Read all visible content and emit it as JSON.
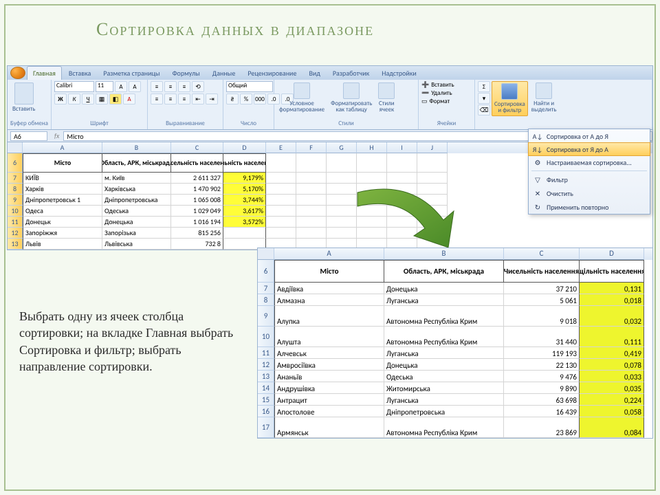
{
  "slide": {
    "title": "Сортировка данных в диапазоне"
  },
  "ribbon": {
    "tabs": [
      "Главная",
      "Вставка",
      "Разметка страницы",
      "Формулы",
      "Данные",
      "Рецензирование",
      "Вид",
      "Разработчик",
      "Надстройки"
    ],
    "active_tab": 0,
    "clipboard": {
      "paste": "Вставить",
      "label": "Буфер обмена"
    },
    "font": {
      "name": "Calibri",
      "size": "11",
      "label": "Шрифт"
    },
    "alignment": {
      "label": "Выравнивание"
    },
    "number": {
      "format": "Общий",
      "label": "Число"
    },
    "styles": {
      "cond_format": "Условное\nформатирование",
      "as_table": "Форматировать\nкак таблицу",
      "cell_styles": "Стили\nячеек",
      "label": "Стили"
    },
    "cells": {
      "insert": "Вставить",
      "delete": "Удалить",
      "format": "Формат",
      "label": "Ячейки"
    },
    "editing": {
      "sort_filter": "Сортировка\nи фильтр",
      "find_select": "Найти и\nвыделить"
    }
  },
  "formula_bar": {
    "name_box": "A6",
    "content": "Місто"
  },
  "sheet1": {
    "cols": [
      "A",
      "B",
      "C",
      "D",
      "E",
      "F",
      "G",
      "H",
      "I",
      "J"
    ],
    "headers": [
      "Місто",
      "Область, АРК, міськрада",
      "Чисельність населення",
      "щільність населення"
    ],
    "rows": [
      {
        "n": "7",
        "a": "КИЇВ",
        "b": "м. Київ",
        "c": "2 611 327",
        "d": "9,179%"
      },
      {
        "n": "8",
        "a": "Харків",
        "b": "Харківська",
        "c": "1 470 902",
        "d": "5,170%"
      },
      {
        "n": "9",
        "a": "Дніпропетровськ 1",
        "b": "Дніпропетровська",
        "c": "1 065 008",
        "d": "3,744%"
      },
      {
        "n": "10",
        "a": "Одеса",
        "b": "Одеська",
        "c": "1 029 049",
        "d": "3,617%"
      },
      {
        "n": "11",
        "a": "Донецьк",
        "b": "Донецька",
        "c": "1 016 194",
        "d": "3,572%"
      },
      {
        "n": "12",
        "a": "Запоріжжя",
        "b": "Запорізька",
        "c": "815 256",
        "d": ""
      },
      {
        "n": "13",
        "a": "Львів",
        "b": "Львівська",
        "c": "732 8",
        "d": ""
      }
    ]
  },
  "sort_menu": {
    "az": "Сортировка от А до Я",
    "za": "Сортировка от Я до А",
    "custom": "Настраиваемая сортировка...",
    "filter": "Фильтр",
    "clear": "Очистить",
    "reapply": "Применить повторно"
  },
  "instructions": {
    "text": "Выбрать одну из ячеек столбца сортировки; на вкладке Главная выбрать Сортировка и фильтр; выбрать направление сортировки."
  },
  "sheet2": {
    "cols": [
      "A",
      "B",
      "C",
      "D"
    ],
    "headers": [
      "Місто",
      "Область, АРК, міськрада",
      "Чисельність населення",
      "щільність населення"
    ],
    "rows": [
      {
        "n": "7",
        "a": "Авдіївка",
        "b": "Донецька",
        "c": "37 210",
        "d": "0,131",
        "tall": false
      },
      {
        "n": "8",
        "a": "Алмазна",
        "b": "Луганська",
        "c": "5 061",
        "d": "0,018",
        "tall": false
      },
      {
        "n": "9",
        "a": "Алупка",
        "b": "Автономна Республіка Крим",
        "c": "9 018",
        "d": "0,032",
        "tall": true
      },
      {
        "n": "10",
        "a": "Алушта",
        "b": "Автономна Республіка Крим",
        "c": "31 440",
        "d": "0,111",
        "tall": true
      },
      {
        "n": "11",
        "a": "Алчевськ",
        "b": "Луганська",
        "c": "119 193",
        "d": "0,419",
        "tall": false
      },
      {
        "n": "12",
        "a": "Амвросіївка",
        "b": "Донецька",
        "c": "22 130",
        "d": "0,078",
        "tall": false
      },
      {
        "n": "13",
        "a": "Ананьїв",
        "b": "Одеська",
        "c": "9 476",
        "d": "0,033",
        "tall": false
      },
      {
        "n": "14",
        "a": "Андрушівка",
        "b": "Житомирська",
        "c": "9 890",
        "d": "0,035",
        "tall": false
      },
      {
        "n": "15",
        "a": "Антрацит",
        "b": "Луганська",
        "c": "63 698",
        "d": "0,224",
        "tall": false
      },
      {
        "n": "16",
        "a": "Апостолове",
        "b": "Дніпропетровська",
        "c": "16 439",
        "d": "0,058",
        "tall": false
      },
      {
        "n": "17",
        "a": "Армянськ",
        "b": "Автономна Республіка Крим",
        "c": "23 869",
        "d": "0,084",
        "tall": true
      }
    ]
  }
}
